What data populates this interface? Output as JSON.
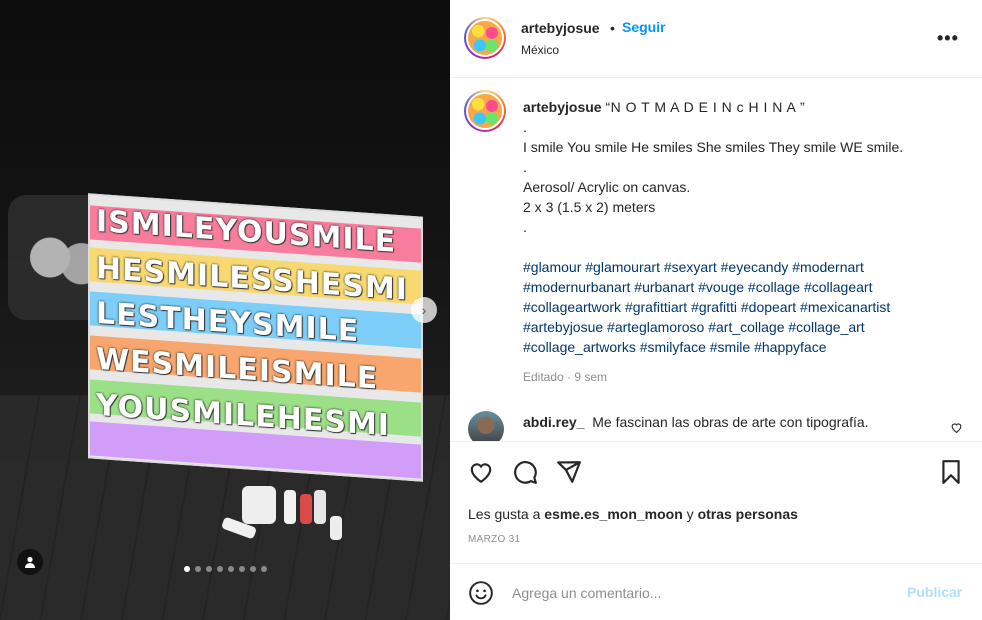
{
  "post": {
    "username": "artebyjosue",
    "follow_label": "Seguir",
    "separator": "•",
    "location": "México",
    "more_label": "•••"
  },
  "caption": {
    "username": "artebyjosue",
    "title": "“N O T M A D E I N c H I N A ”",
    "lines": [
      ".",
      "I smile You smile He smiles She smiles They smile WE smile.",
      ".",
      "Aerosol/ Acrylic on canvas.",
      "2 x 3 (1.5 x 2) meters",
      "."
    ],
    "hashtag_lines": [
      "#glamour #glamourart #sexyart #eyecandy #modernart",
      "#modernurbanart #urbanart #vouge #collage #collageart",
      "#collageartwork #grafittiart #grafitti #dopeart #mexicanartist",
      "#artebyjosue #arteglamoroso #art_collage #collage_art",
      "#collage_artworks #smilyface #smile #happyface"
    ],
    "edited": "Editado · 9 sem"
  },
  "comment": {
    "username": "abdi.rey_",
    "text": "Me fascinan las obras de arte con tipografía."
  },
  "likes": {
    "prefix": "Les gusta a",
    "user": "esme.es_mon_moon",
    "conjunction": "y",
    "others": "otras personas"
  },
  "date": "MARZO 31",
  "add_comment": {
    "placeholder": "Agrega un comentario...",
    "post_label": "Publicar"
  },
  "carousel": {
    "total_slides": 8,
    "active_index": 0
  },
  "artwork_words": [
    "ISMILEYOUSMILE",
    "HESMILESSHESMI",
    "LESTHEYSMILE",
    "WESMILEISMILE",
    "YOUSMILEHESMI"
  ],
  "colors": {
    "accent": "#0095f6",
    "link": "#00376b",
    "muted": "#8e8e8e",
    "publish_disabled": "#b2dffc"
  }
}
